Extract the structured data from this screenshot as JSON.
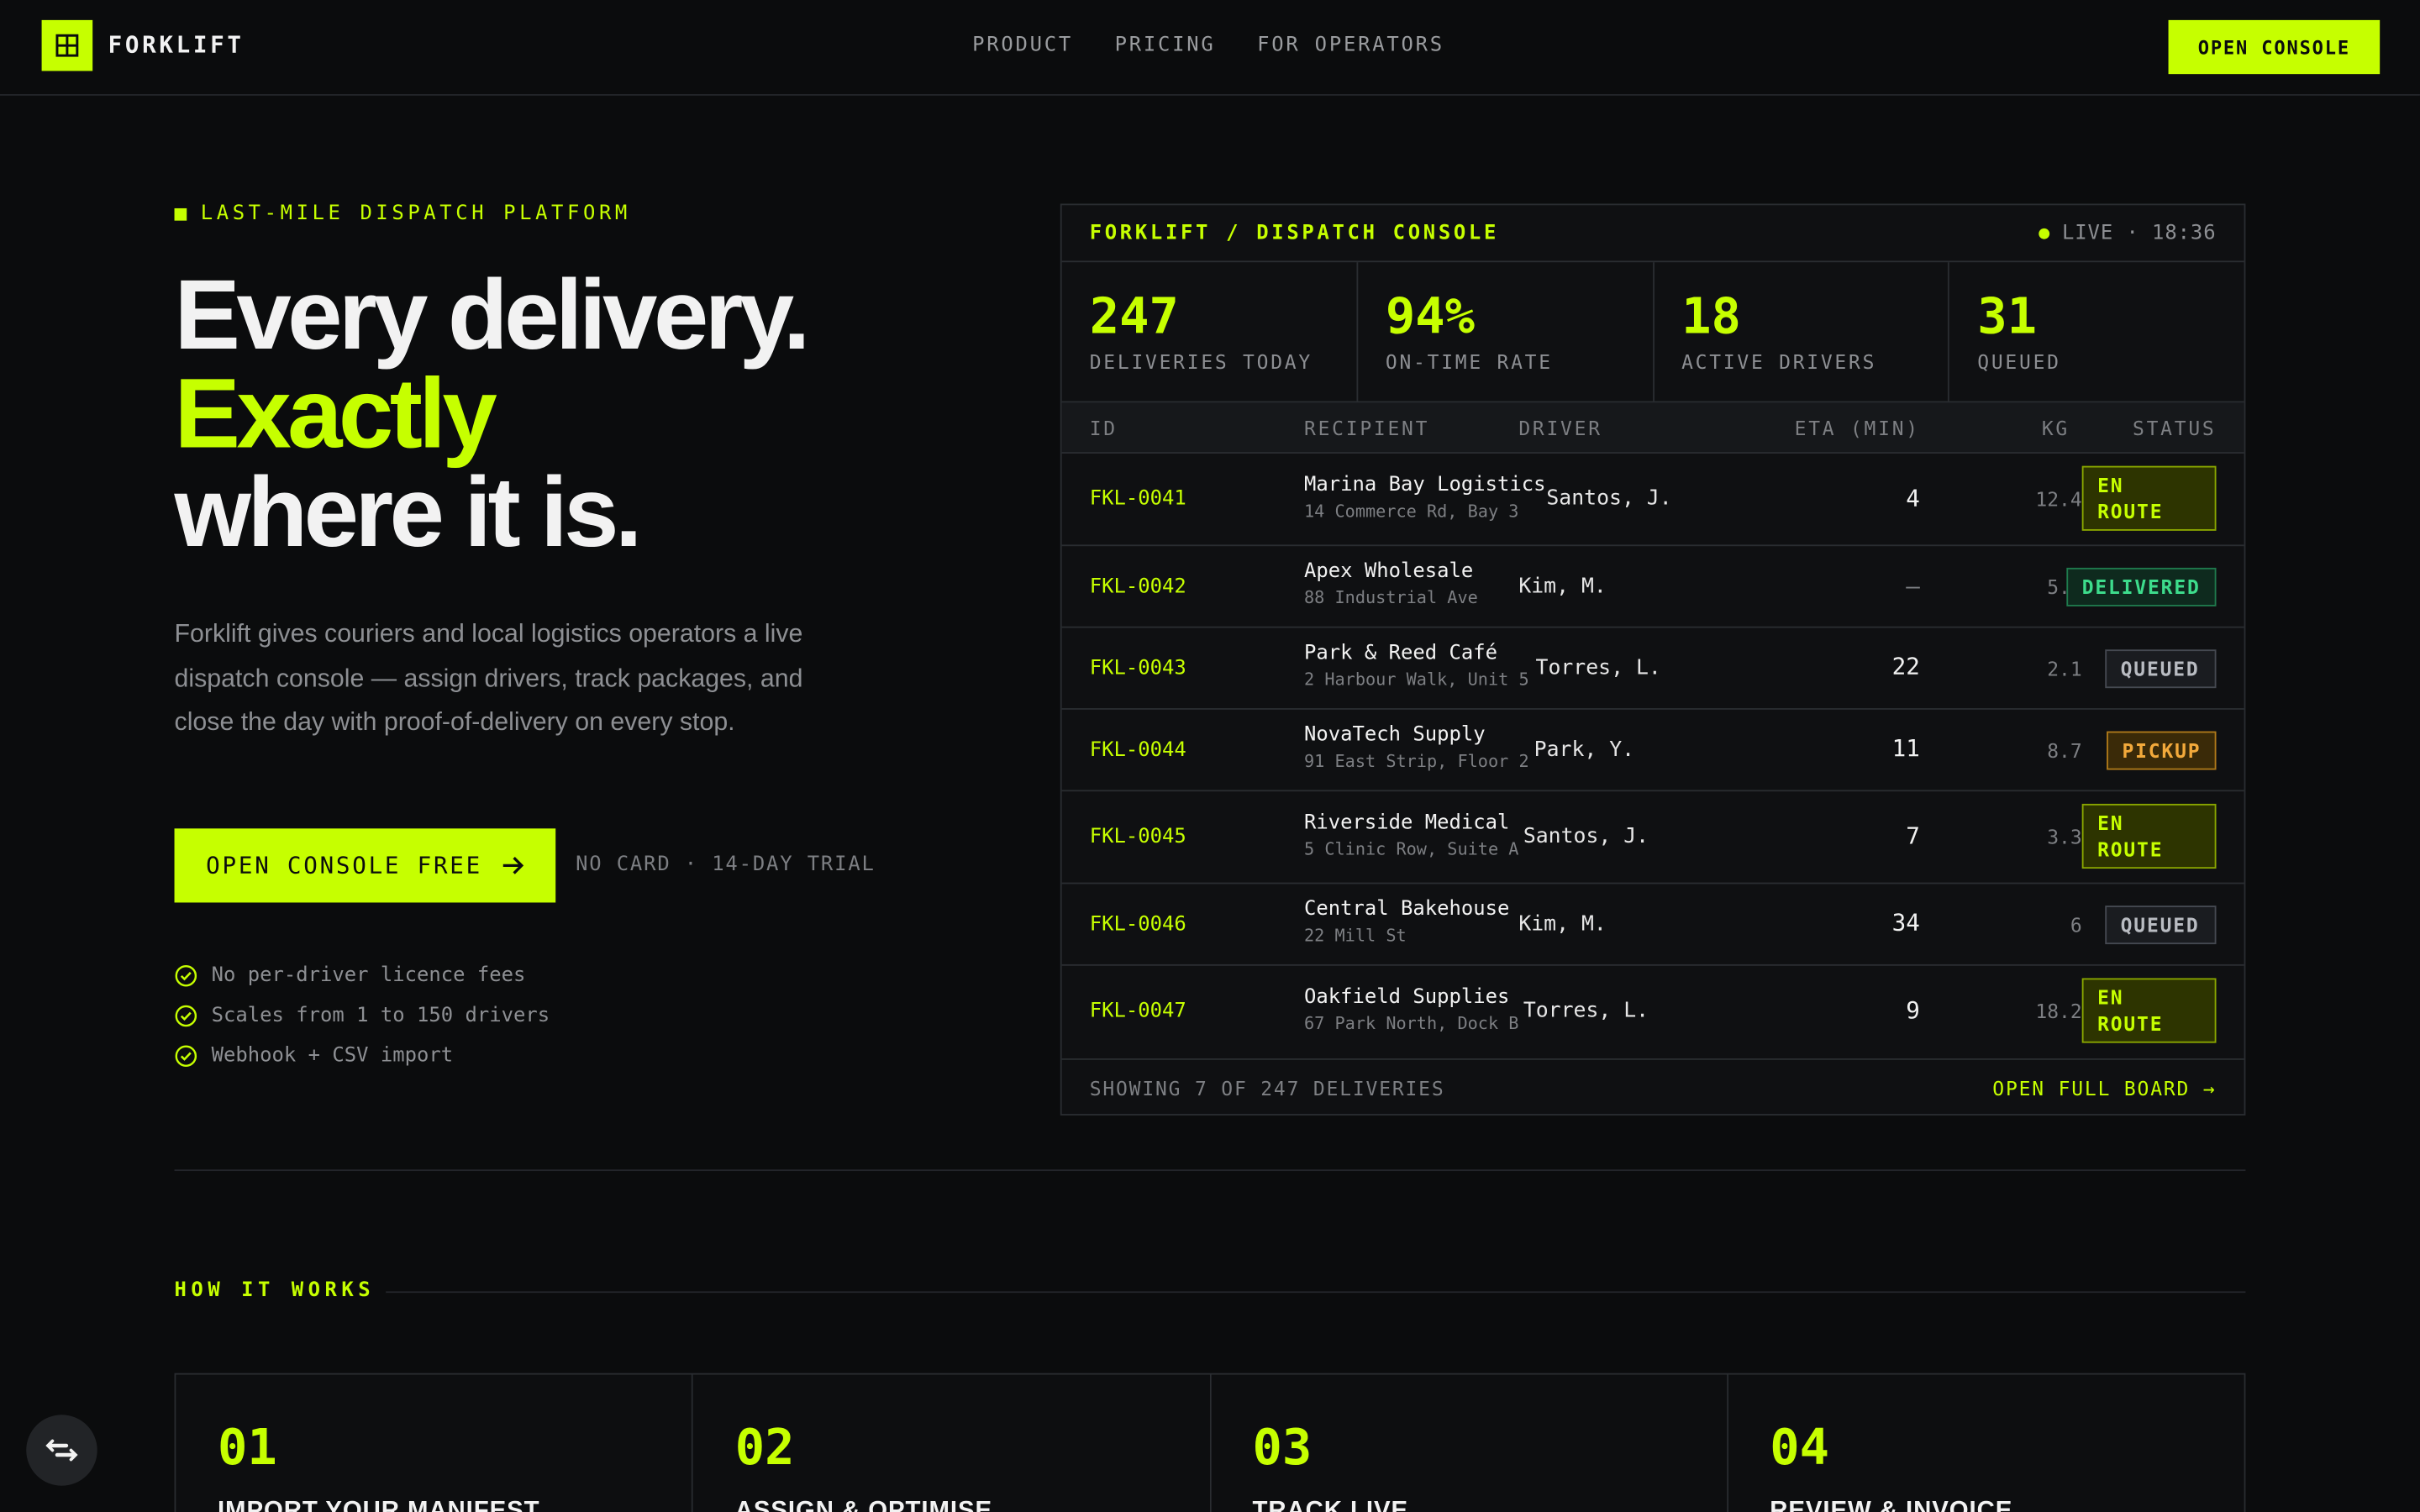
{
  "nav": {
    "logo": "FORKLIFT",
    "links": [
      "PRODUCT",
      "PRICING",
      "FOR OPERATORS"
    ],
    "cta": "OPEN CONSOLE"
  },
  "hero": {
    "eyebrow": "LAST-MILE DISPATCH PLATFORM",
    "headline_1": "Every delivery.",
    "headline_2": "Exactly",
    "headline_3": "where it is.",
    "lead": "Forklift gives couriers and local logistics operators a live dispatch console — assign drivers, track packages, and close the day with proof-of-delivery on every stop.",
    "cta": "OPEN CONSOLE FREE",
    "cta_note": "NO CARD · 14-DAY TRIAL",
    "features": [
      "No per-driver licence fees",
      "Scales from 1 to 150 drivers",
      "Webhook + CSV import"
    ]
  },
  "console": {
    "title": "FORKLIFT / DISPATCH CONSOLE",
    "live": "LIVE · 18:36",
    "stats": [
      {
        "value": "247",
        "label": "DELIVERIES TODAY"
      },
      {
        "value": "94%",
        "label": "ON-TIME RATE"
      },
      {
        "value": "18",
        "label": "ACTIVE DRIVERS"
      },
      {
        "value": "31",
        "label": "QUEUED"
      }
    ],
    "columns": {
      "id": "ID",
      "recipient": "RECIPIENT",
      "driver": "DRIVER",
      "eta": "ETA (MIN)",
      "kg": "KG",
      "status": "STATUS"
    },
    "rows": [
      {
        "id": "FKL-0041",
        "name": "Marina Bay Logistics",
        "addr": "14 Commerce Rd, Bay 3",
        "driver": "Santos, J.",
        "eta": "4",
        "kg": "12.4",
        "status": "EN ROUTE",
        "kind": "enroute"
      },
      {
        "id": "FKL-0042",
        "name": "Apex Wholesale",
        "addr": "88 Industrial Ave",
        "driver": "Kim, M.",
        "eta": "—",
        "kg": "5.8",
        "status": "DELIVERED",
        "kind": "delivered"
      },
      {
        "id": "FKL-0043",
        "name": "Park & Reed Café",
        "addr": "2 Harbour Walk, Unit 5",
        "driver": "Torres, L.",
        "eta": "22",
        "kg": "2.1",
        "status": "QUEUED",
        "kind": "queued"
      },
      {
        "id": "FKL-0044",
        "name": "NovaTech Supply",
        "addr": "91 East Strip, Floor 2",
        "driver": "Park, Y.",
        "eta": "11",
        "kg": "8.7",
        "status": "PICKUP",
        "kind": "pickup"
      },
      {
        "id": "FKL-0045",
        "name": "Riverside Medical",
        "addr": "5 Clinic Row, Suite A",
        "driver": "Santos, J.",
        "eta": "7",
        "kg": "3.3",
        "status": "EN ROUTE",
        "kind": "enroute"
      },
      {
        "id": "FKL-0046",
        "name": "Central Bakehouse",
        "addr": "22 Mill St",
        "driver": "Kim, M.",
        "eta": "34",
        "kg": "6",
        "status": "QUEUED",
        "kind": "queued"
      },
      {
        "id": "FKL-0047",
        "name": "Oakfield Supplies",
        "addr": "67 Park North, Dock B",
        "driver": "Torres, L.",
        "eta": "9",
        "kg": "18.2",
        "status": "EN ROUTE",
        "kind": "enroute"
      }
    ],
    "footer_left": "SHOWING 7 OF 247 DELIVERIES",
    "footer_right": "OPEN FULL BOARD →"
  },
  "how": {
    "label": "HOW IT WORKS",
    "steps": [
      {
        "num": "01",
        "title": "IMPORT YOUR MANIFEST"
      },
      {
        "num": "02",
        "title": "ASSIGN & OPTIMISE"
      },
      {
        "num": "03",
        "title": "TRACK LIVE"
      },
      {
        "num": "04",
        "title": "REVIEW & INVOICE"
      }
    ]
  },
  "colors": {
    "accent": "#c6ff00",
    "background": "#0b0c0d",
    "delivered": "#3ddc8c",
    "pickup": "#f2a93b"
  },
  "icons": {
    "logo": "grid-box-icon",
    "check": "check-circle-icon",
    "arrow": "arrow-right-icon",
    "fab": "chat-widget-icon"
  }
}
